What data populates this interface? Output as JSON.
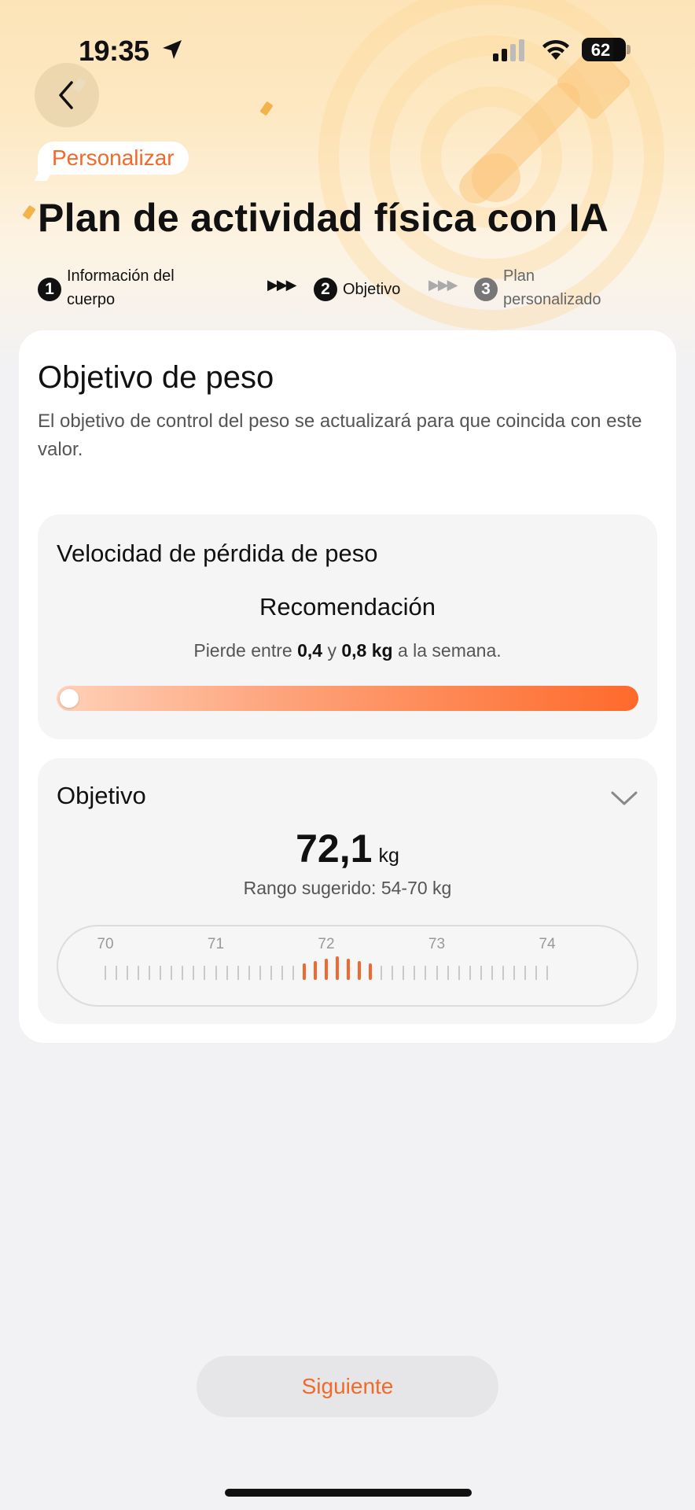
{
  "status_bar": {
    "time": "19:35",
    "battery": "62"
  },
  "header": {
    "tag": "Personalizar",
    "title": "Plan de actividad física con IA"
  },
  "stepper": {
    "steps": [
      {
        "number": "1",
        "label_line1": "Información del",
        "label_line2": "cuerpo"
      },
      {
        "number": "2",
        "label_line1": "Objetivo"
      },
      {
        "number": "3",
        "label_line1": "Plan",
        "label_line2": "personalizado"
      }
    ]
  },
  "main": {
    "section_title": "Objetivo de peso",
    "section_desc": "El objetivo de control del peso se actualizará para que coincida con este valor.",
    "speed": {
      "title": "Velocidad de pérdida de peso",
      "recommendation_title": "Recomendación",
      "text_prefix": "Pierde entre",
      "min": "0,4",
      "connector": "y",
      "max": "0,8 kg",
      "text_suffix": "a la semana.",
      "slider_fraction": 0.0
    },
    "goal": {
      "title": "Objetivo",
      "value": "72,1",
      "unit": "kg",
      "range": "Rango sugerido: 54-70 kg",
      "ruler_labels": [
        "70",
        "71",
        "72",
        "73",
        "74"
      ]
    }
  },
  "footer": {
    "next_label": "Siguiente"
  },
  "colors": {
    "accent": "#f06a2a",
    "slider_start": "#ffd1b8",
    "slider_end": "#ff6a2a"
  },
  "icons": {
    "back": "chevron-left-icon",
    "dropdown": "chevron-down-icon",
    "location": "location-arrow-icon",
    "signal": "cellular-signal-icon",
    "wifi": "wifi-icon"
  }
}
